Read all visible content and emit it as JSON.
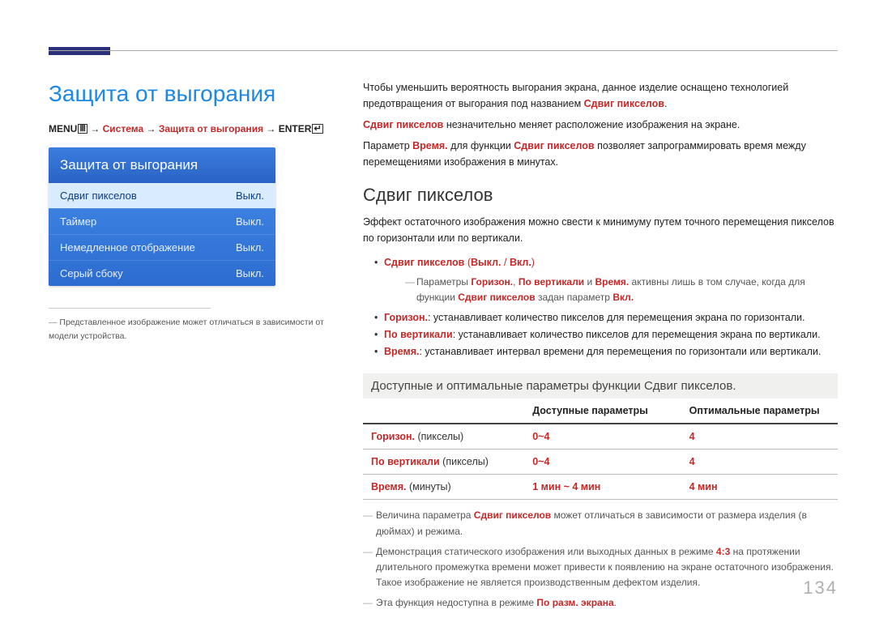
{
  "pageTitle": "Защита от выгорания",
  "breadcrumb": {
    "menu": "MENU",
    "system": "Система",
    "screenBurn": "Защита от выгорания",
    "enter": "ENTER"
  },
  "menuPanel": {
    "header": "Защита от выгорания",
    "rows": [
      {
        "label": "Сдвиг пикселов",
        "value": "Выкл.",
        "selected": true
      },
      {
        "label": "Таймер",
        "value": "Выкл.",
        "selected": false
      },
      {
        "label": "Немедленное отображение",
        "value": "Выкл.",
        "selected": false
      },
      {
        "label": "Серый сбоку",
        "value": "Выкл.",
        "selected": false
      }
    ],
    "footnote": "Представленное изображение может отличаться в зависимости от модели устройства."
  },
  "intro": {
    "p1a": "Чтобы уменьшить вероятность выгорания экрана, данное изделие оснащено технологией предотвращения от выгорания под названием ",
    "p1hl": "Сдвиг пикселов",
    "p1b": ".",
    "p2hl": "Сдвиг пикселов",
    "p2a": " незначительно меняет расположение изображения на экране.",
    "p3a": "Параметр ",
    "p3hl1": "Время.",
    "p3b": " для функции ",
    "p3hl2": "Сдвиг пикселов",
    "p3c": " позволяет запрограммировать время между перемещениями изображения в минутах."
  },
  "section": {
    "title": "Сдвиг пикселов",
    "desc": "Эффект остаточного изображения можно свести к минимуму путем точного перемещения пикселов по горизонтали или по вертикали.",
    "b1a": "Сдвиг пикселов",
    "b1b": " (",
    "b1c": "Выкл.",
    "b1d": " / ",
    "b1e": "Вкл.",
    "b1f": ")",
    "note1a": "Параметры ",
    "note1h1": "Горизон.",
    "note1b": ", ",
    "note1h2": "По вертикали",
    "note1c": " и ",
    "note1h3": "Время.",
    "note1d": " активны лишь в том случае, когда для функции ",
    "note1h4": "Сдвиг пикселов",
    "note1e": " задан параметр ",
    "note1h5": "Вкл.",
    "b2hl": "Горизон.",
    "b2a": ": устанавливает количество пикселов для перемещения экрана по горизонтали.",
    "b3hl": "По вертикали",
    "b3a": ": устанавливает количество пикселов для перемещения экрана по вертикали.",
    "b4hl": "Время.",
    "b4a": ": устанавливает интервал времени для перемещения по горизонтали или вертикали."
  },
  "tableTitle": "Доступные и оптимальные параметры функции Сдвиг пикселов.",
  "table": {
    "head": [
      "",
      "Доступные параметры",
      "Оптимальные параметры"
    ],
    "rows": [
      {
        "labelHl": "Горизон.",
        "labelRest": " (пикселы)",
        "avail": "0~4",
        "opt": "4"
      },
      {
        "labelHl": "По вертикали",
        "labelRest": " (пикселы)",
        "avail": "0~4",
        "opt": "4"
      },
      {
        "labelHl": "Время.",
        "labelRest": " (минуты)",
        "avail": "1 мин ~ 4 мин",
        "opt": "4 мин"
      }
    ]
  },
  "footnotes": {
    "f1a": "Величина параметра ",
    "f1hl": "Сдвиг пикселов",
    "f1b": " может отличаться в зависимости от размера изделия (в дюймах) и режима.",
    "f2a": "Демонстрация статического изображения или выходных данных в режиме ",
    "f2hl": "4:3",
    "f2b": " на протяжении длительного промежутка времени может привести к появлению на экране остаточного изображения. Такое изображение не является производственным дефектом изделия.",
    "f3a": "Эта функция недоступна в режиме ",
    "f3hl": "По разм. экрана",
    "f3b": "."
  },
  "pageNumber": "134"
}
